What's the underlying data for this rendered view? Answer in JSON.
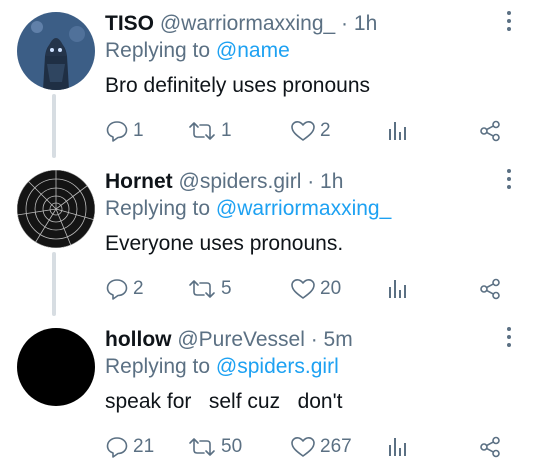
{
  "tweets": [
    {
      "name": "TISO",
      "handle": "@warriormaxxing_ · 1h",
      "replying_prefix": "Replying to ",
      "replying_to": "@name",
      "text": "Bro definitely uses pronouns",
      "replies": "1",
      "retweets": "1",
      "likes": "2",
      "avatar_bg": "#3c5e86"
    },
    {
      "name": "Hornet",
      "handle": "@spiders.girl · 1h",
      "replying_prefix": "Replying to ",
      "replying_to": "@warriormaxxing_",
      "text": "Everyone uses pronouns.",
      "replies": "2",
      "retweets": "5",
      "likes": "20",
      "avatar_bg": "#141414"
    },
    {
      "name": "hollow",
      "handle": "@PureVessel · 5m",
      "replying_prefix": "Replying to ",
      "replying_to": "@spiders.girl",
      "text": "speak for   self cuz   don't",
      "replies": "21",
      "retweets": "50",
      "likes": "267",
      "avatar_bg": "#000000"
    }
  ],
  "colors": {
    "accent": "#1da1f2",
    "muted": "#5b7083",
    "thread_line": "#d7dde2"
  }
}
